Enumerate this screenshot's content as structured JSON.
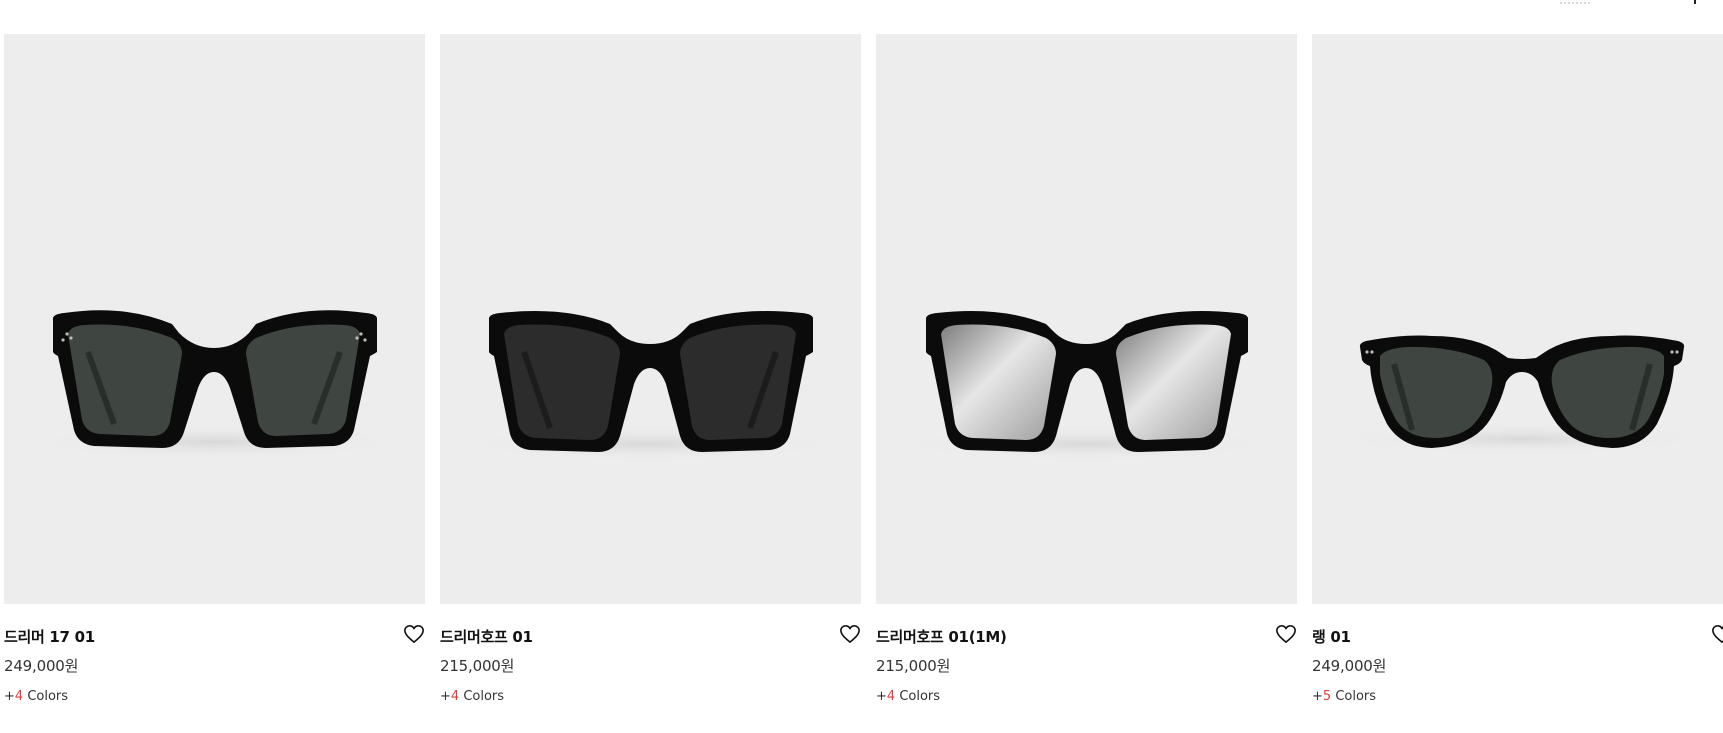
{
  "products": [
    {
      "name": "드리머 17 01",
      "price": "249,000원",
      "colors_plus": "+",
      "colors_count": "4",
      "colors_label": " Colors",
      "image_icon": "sunglasses-square-oversized-dark-lens"
    },
    {
      "name": "드리머호프 01",
      "price": "215,000원",
      "colors_plus": "+",
      "colors_count": "4",
      "colors_label": " Colors",
      "image_icon": "sunglasses-square-black-lens"
    },
    {
      "name": "드리머호프 01(1M)",
      "price": "215,000원",
      "colors_plus": "+",
      "colors_count": "4",
      "colors_label": " Colors",
      "image_icon": "sunglasses-square-mirror-lens"
    },
    {
      "name": "랭 01",
      "price": "249,000원",
      "colors_plus": "+",
      "colors_count": "5",
      "colors_label": " Colors",
      "image_icon": "sunglasses-round-dark-lens"
    }
  ],
  "wishlist_icon": "heart-outline-icon",
  "colors": {
    "image_bg": "#ededed",
    "frame": "#0b0b0b",
    "lens_green": "#3f4540",
    "lens_dark": "#2c2c2c",
    "lens_mirror": "#c9c9c9",
    "accent_count": "#d0453f"
  }
}
